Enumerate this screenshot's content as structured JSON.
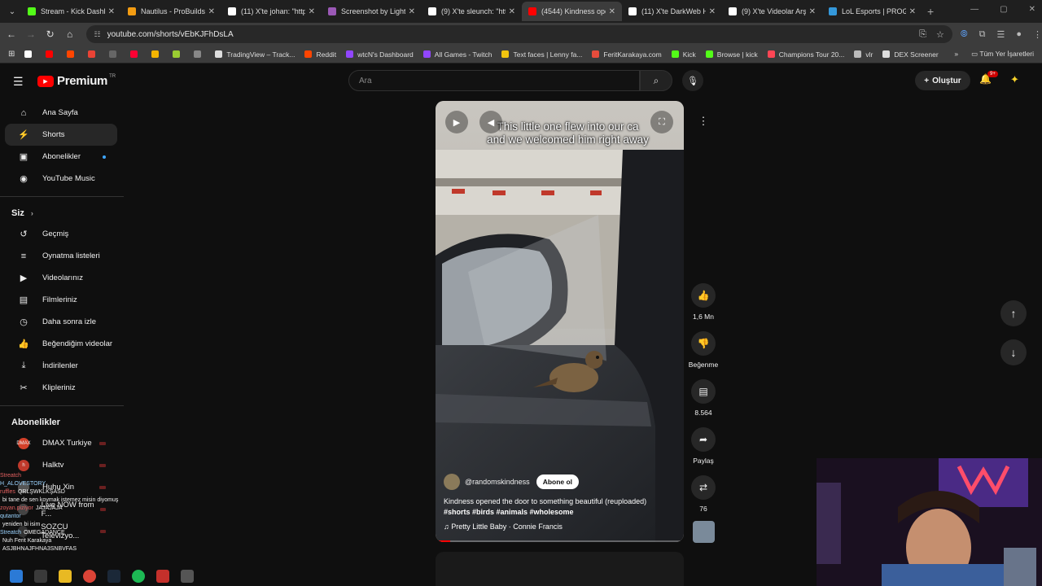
{
  "browser": {
    "tabs": [
      {
        "title": "Stream - Kick Dashbo",
        "color": "#53fc18"
      },
      {
        "title": "Nautilus - ProBuilds.n",
        "color": "#f39c12"
      },
      {
        "title": "(11) X'te johan: \"http",
        "color": "#ffffff"
      },
      {
        "title": "Screenshot by Lightsh",
        "color": "#9b59b6"
      },
      {
        "title": "(9) X'te sleunch: \"http",
        "color": "#ffffff"
      },
      {
        "title": "(4544) Kindness ope",
        "color": "#ff0000",
        "active": true
      },
      {
        "title": "(11) X'te DarkWeb Hu",
        "color": "#ffffff"
      },
      {
        "title": "(9) X'te Videolar Arşi",
        "color": "#ffffff"
      },
      {
        "title": "LoL Esports | PROGRA",
        "color": "#3498db"
      }
    ],
    "url": "youtube.com/shorts/vEbKJFhDsLA",
    "bookmarks": [
      {
        "label": "",
        "color": "#ffffff"
      },
      {
        "label": "",
        "color": "#ff0000"
      },
      {
        "label": "",
        "color": "#ff4500"
      },
      {
        "label": "",
        "color": "#ea4335"
      },
      {
        "label": "",
        "color": "#666666"
      },
      {
        "label": "",
        "color": "#ff0033"
      },
      {
        "label": "",
        "color": "#f4b400"
      },
      {
        "label": "",
        "color": "#9acd32"
      },
      {
        "label": "",
        "color": "#888888"
      },
      {
        "label": "TradingView – Track...",
        "color": "#dddddd"
      },
      {
        "label": "Reddit",
        "color": "#ff4500"
      },
      {
        "label": "wtcN's Dashboard",
        "color": "#9146ff"
      },
      {
        "label": "All Games - Twitch",
        "color": "#9146ff"
      },
      {
        "label": "Text faces | Lenny fa...",
        "color": "#f1c40f"
      },
      {
        "label": "FeritKarakaya.com",
        "color": "#e74c3c"
      },
      {
        "label": "Kick",
        "color": "#53fc18"
      },
      {
        "label": "Browse | kick",
        "color": "#53fc18"
      },
      {
        "label": "Champions Tour 20...",
        "color": "#ff4655"
      },
      {
        "label": "vlr",
        "color": "#bbbbbb"
      },
      {
        "label": "DEX Screener",
        "color": "#dddddd"
      }
    ],
    "all_bookmarks_label": "Tüm Yer İşaretleri"
  },
  "header": {
    "logo_text": "Premium",
    "region": "TR",
    "search_placeholder": "Ara",
    "create_label": "Oluştur",
    "notif_count": "9+"
  },
  "sidebar": {
    "main": [
      {
        "label": "Ana Sayfa",
        "icon": "home-icon",
        "glyph": "⌂"
      },
      {
        "label": "Shorts",
        "icon": "shorts-icon",
        "glyph": "⚡",
        "active": true
      },
      {
        "label": "Abonelikler",
        "icon": "subscriptions-icon",
        "glyph": "▣",
        "dot": true
      },
      {
        "label": "YouTube Music",
        "icon": "music-icon",
        "glyph": "◉"
      }
    ],
    "you_title": "Siz",
    "you": [
      {
        "label": "Geçmiş",
        "icon": "history-icon",
        "glyph": "↺"
      },
      {
        "label": "Oynatma listeleri",
        "icon": "playlists-icon",
        "glyph": "≡"
      },
      {
        "label": "Videolarınız",
        "icon": "your-videos-icon",
        "glyph": "▶"
      },
      {
        "label": "Filmleriniz",
        "icon": "movies-icon",
        "glyph": "▤"
      },
      {
        "label": "Daha sonra izle",
        "icon": "watch-later-icon",
        "glyph": "◷"
      },
      {
        "label": "Beğendiğim videolar",
        "icon": "liked-icon",
        "glyph": "👍"
      },
      {
        "label": "İndirilenler",
        "icon": "downloads-icon",
        "glyph": "⤓"
      },
      {
        "label": "Klipleriniz",
        "icon": "clips-icon",
        "glyph": "✂"
      }
    ],
    "subs_title": "Abonelikler",
    "channels": [
      {
        "label": "DMAX Turkiye",
        "color": "#d4412a",
        "abbr": "DMAX"
      },
      {
        "label": "Halktv",
        "color": "#c0392b",
        "abbr": "h"
      },
      {
        "label": "Huhu Xin",
        "color": "#555555",
        "abbr": ""
      },
      {
        "label": "Live NOW from F...",
        "color": "#444444",
        "abbr": ""
      },
      {
        "label": "SOZCU Televizyo...",
        "color": "#333333",
        "abbr": ""
      }
    ]
  },
  "short": {
    "caption_line1": "This little one flew into our ca",
    "caption_line2": "and we welcomed him right away",
    "channel": "@randomskindness",
    "subscribe_label": "Abone ol",
    "description": "Kindness opened the door to something beautiful (reuploaded)",
    "hashtags": "#shorts #birds #animals #wholesome",
    "music": "Pretty Little Baby · Connie Francis",
    "progress_fraction": 0.06
  },
  "actions": {
    "likes": "1,6 Mn",
    "dislike_label": "Beğenme",
    "comments": "8.564",
    "share_label": "Paylaş",
    "remix_count": "76"
  },
  "chat": [
    {
      "user": "Streatch",
      "msg": ""
    },
    {
      "user": "H_ALOVESTORY",
      "msg": ""
    },
    {
      "user": "ruffles",
      "msg": "QRLŞWKLKŞASD"
    },
    {
      "user": "",
      "msg": "bi tane de sen koymak istemez misin diyomuş"
    },
    {
      "user": "zoyan.piziyor",
      "msg": "JAJAJAJA"
    },
    {
      "user": "qutantor",
      "msg": ""
    },
    {
      "user": "",
      "msg": "yeniden bi isim"
    },
    {
      "user": "Streatch",
      "msg": "OMEGADANCE"
    },
    {
      "user": "",
      "msg": "Nuh Ferit Karakaya"
    },
    {
      "user": "",
      "msg": "ASJBHNAJFHNA3SNBVFAS"
    }
  ]
}
